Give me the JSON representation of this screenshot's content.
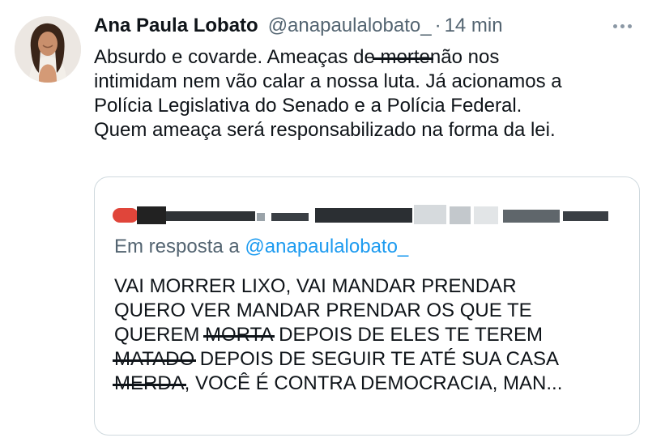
{
  "author": {
    "name": "Ana Paula Lobato",
    "handle": "@anapaulalobato_",
    "separator": "·",
    "time": "14 min"
  },
  "tweet": {
    "line1_a": "Absurdo e covarde. Ameaças de",
    "line1_struck": "morte",
    "line1_b": "não nos",
    "line2": "intimidam nem vão calar a nossa luta. Já acionamos a",
    "line3": "Polícia Legislativa do Senado e a Polícia Federal.",
    "line4": "Quem ameaça será responsabilizado na forma da lei."
  },
  "quote": {
    "reply_prefix": "Em resposta a",
    "reply_mention": "@anapaulalobato_",
    "line1": "VAI MORRER LIXO, VAI MANDAR PRENDAR",
    "line2": "QUERO VER MANDAR PRENDAR OS QUE TE",
    "line3_a": "QUEREM",
    "line3_struck": "MORTA",
    "line3_b": "DEPOIS DE ELES TE TEREM",
    "line4_struck": "MATADO",
    "line4_b": "DEPOIS DE SEGUIR TE ATÉ SUA CASA",
    "line5_struck": "MERDA",
    "line5_b": ", VOCÊ É CONTRA DEMOCRACIA, MAN..."
  },
  "icons": {
    "more": "more-dots-icon",
    "avatar": "profile-photo"
  }
}
